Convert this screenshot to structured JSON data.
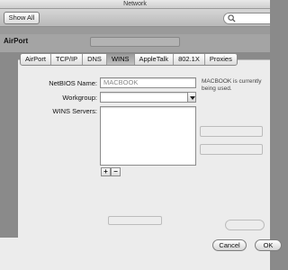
{
  "window": {
    "title": "Network"
  },
  "toolbar": {
    "show_all": "Show All"
  },
  "location": {
    "interface_title": "AirPort"
  },
  "tabs": [
    {
      "label": "AirPort",
      "active": false
    },
    {
      "label": "TCP/IP",
      "active": false
    },
    {
      "label": "DNS",
      "active": false
    },
    {
      "label": "WINS",
      "active": true
    },
    {
      "label": "AppleTalk",
      "active": false
    },
    {
      "label": "802.1X",
      "active": false
    },
    {
      "label": "Proxies",
      "active": false
    }
  ],
  "wins": {
    "netbios_label": "NetBIOS Name:",
    "netbios_placeholder": "MACBOOK",
    "netbios_note": "MACBOOK is currently being used.",
    "workgroup_label": "Workgroup:",
    "workgroup_value": "",
    "servers_label": "WINS Servers:",
    "servers": [],
    "add_label": "+",
    "remove_label": "−"
  },
  "footer": {
    "cancel_label": "Cancel",
    "ok_label": "OK"
  }
}
